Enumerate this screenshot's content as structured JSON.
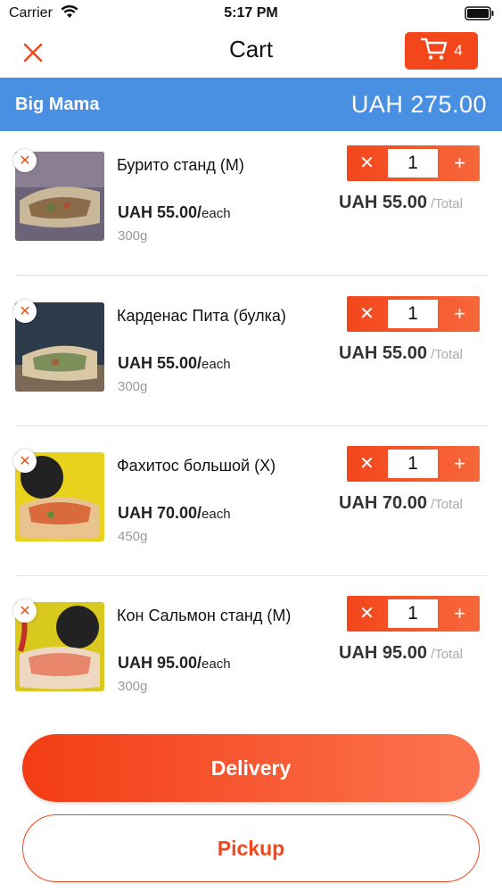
{
  "status_bar": {
    "carrier": "Carrier",
    "time": "5:17 PM"
  },
  "nav": {
    "title": "Cart",
    "cart_count": "4"
  },
  "restaurant": {
    "name": "Big Mama",
    "total": "UAH 275.00"
  },
  "items": [
    {
      "name": "Бурито станд (M)",
      "price": "UAH 55.00/",
      "per": "each",
      "weight": "300g",
      "qty": "1",
      "line_total": "UAH 55.00",
      "total_suffix": " /Total"
    },
    {
      "name": "Карденас Пита (булка)",
      "price": "UAH 55.00/",
      "per": "each",
      "weight": "300g",
      "qty": "1",
      "line_total": "UAH 55.00",
      "total_suffix": " /Total"
    },
    {
      "name": "Фахитос большой (X)",
      "price": "UAH 70.00/",
      "per": "each",
      "weight": "450g",
      "qty": "1",
      "line_total": "UAH 70.00",
      "total_suffix": " /Total"
    },
    {
      "name": "Кон Сальмон станд (M)",
      "price": "UAH 95.00/",
      "per": "each",
      "weight": "300g",
      "qty": "1",
      "line_total": "UAH 95.00",
      "total_suffix": " /Total"
    }
  ],
  "buttons": {
    "delivery": "Delivery",
    "pickup": "Pickup"
  },
  "colors": {
    "accent": "#f4461b",
    "header_blue": "#4a90e2"
  },
  "icons": {
    "close": "close-icon",
    "cart": "cart-icon",
    "remove": "remove-icon",
    "minus": "minus-icon",
    "plus": "plus-icon"
  }
}
